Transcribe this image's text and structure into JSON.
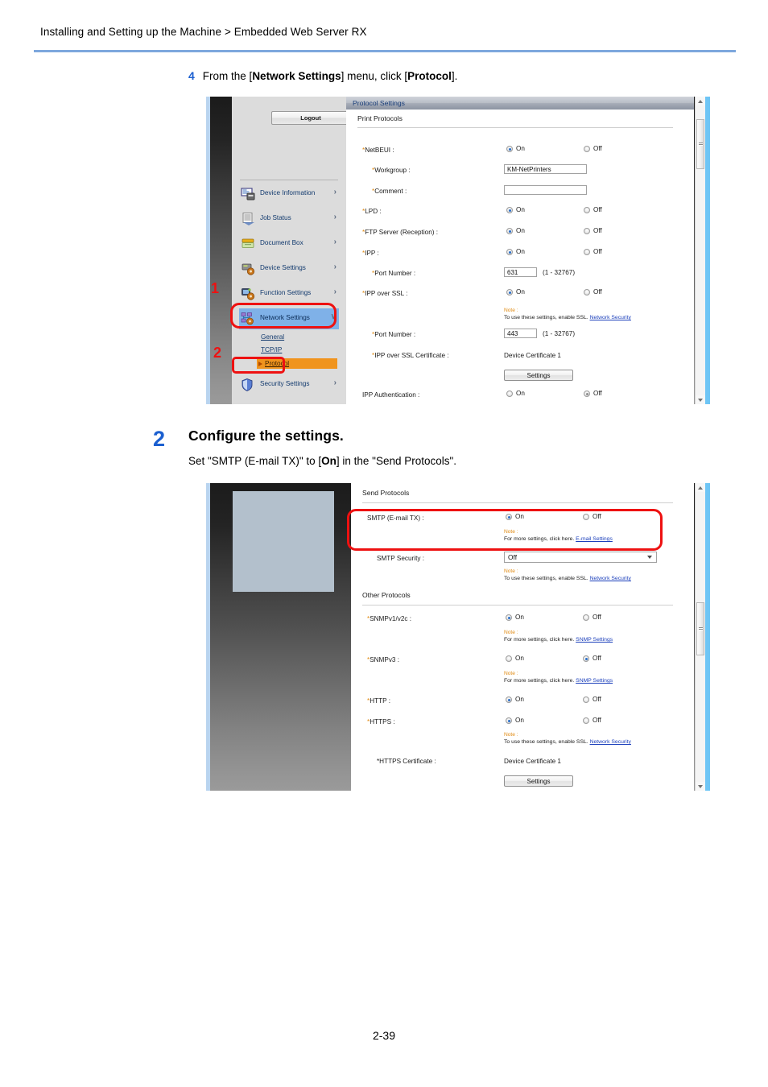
{
  "header": {
    "breadcrumb": "Installing and Setting up the Machine > Embedded Web Server RX"
  },
  "footer": {
    "page_number": "2-39"
  },
  "step4": {
    "number": "4",
    "text_part1": "From the [",
    "bold1": "Network Settings",
    "text_part2": "] menu, click [",
    "bold2": "Protocol",
    "text_part3": "]."
  },
  "step2": {
    "number": "2",
    "title": "Configure the settings.",
    "desc_part1": "Set \"SMTP (E-mail TX)\" to [",
    "desc_bold": "On",
    "desc_part2": "] in the \"Send Protocols\"."
  },
  "annotations": {
    "marker1": "1",
    "marker2": "2"
  },
  "screenshot1": {
    "sidebar": {
      "logout_label": "Logout",
      "items": [
        {
          "label": "Device Information",
          "icon": "device-information-icon",
          "chevron": "›"
        },
        {
          "label": "Job Status",
          "icon": "job-status-icon",
          "chevron": "›"
        },
        {
          "label": "Document Box",
          "icon": "document-box-icon",
          "chevron": "›"
        },
        {
          "label": "Device Settings",
          "icon": "device-settings-icon",
          "chevron": "›"
        },
        {
          "label": "Function Settings",
          "icon": "function-settings-icon",
          "chevron": "›"
        },
        {
          "label": "Network Settings",
          "icon": "network-settings-icon",
          "chevron": "∨",
          "selected": true
        },
        {
          "label": "Security Settings",
          "icon": "security-settings-icon",
          "chevron": "›"
        }
      ],
      "sublinks": [
        "General",
        "TCP/IP"
      ],
      "active_sublink": "Protocol"
    },
    "panel": {
      "title": "Protocol Settings",
      "section": "Print Protocols",
      "on_label": "On",
      "off_label": "Off",
      "rows": [
        {
          "label": "*NetBEUI :",
          "value": "On"
        },
        {
          "label": "*Workgroup :",
          "input": "KM-NetPrinters"
        },
        {
          "label": "*Comment :",
          "input": ""
        },
        {
          "label": "*LPD :",
          "value": "On"
        },
        {
          "label": "*FTP Server (Reception) :",
          "value": "On"
        },
        {
          "label": "*IPP :",
          "value": "On"
        },
        {
          "label": "*Port Number :",
          "input": "631",
          "range": "(1 - 32767)"
        },
        {
          "label": "*IPP over SSL :",
          "value": "On"
        },
        {
          "label": "*Port Number :",
          "input": "443",
          "range": "(1 - 32767)"
        },
        {
          "label": "*IPP over SSL Certificate :",
          "text": "Device Certificate 1"
        },
        {
          "label": "IPP Authentication :",
          "value": "Off"
        }
      ],
      "note_label": "Note :",
      "note_ssl": "To use these settings, enable SSL.",
      "note_ssl_link": "Network Security",
      "settings_button": "Settings"
    }
  },
  "screenshot2": {
    "send_section": "Send Protocols",
    "other_section": "Other Protocols",
    "on_label": "On",
    "off_label": "Off",
    "note_label": "Note :",
    "note_more": "For more settings, click here.",
    "note_ssl": "To use these settings, enable SSL.",
    "links": {
      "email_settings": "E-mail Settings",
      "network_security": "Network Security",
      "snmp_settings": "SNMP Settings"
    },
    "rows": [
      {
        "label": "SMTP (E-mail TX) :",
        "value": "On"
      },
      {
        "label": "SMTP Security :",
        "dropdown": "Off"
      },
      {
        "label": "*SNMPv1/v2c :",
        "value": "On"
      },
      {
        "label": "*SNMPv3 :",
        "value": "Off"
      },
      {
        "label": "*HTTP :",
        "value": "On"
      },
      {
        "label": "*HTTPS :",
        "value": "On"
      },
      {
        "label": "*HTTPS Certificate :",
        "text": "Device Certificate 1"
      }
    ],
    "settings_button": "Settings"
  }
}
